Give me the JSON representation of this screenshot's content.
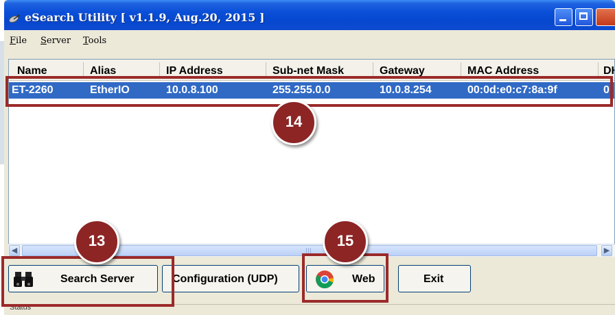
{
  "window": {
    "title": "eSearch Utility [ v1.1.9, Aug.20, 2015 ]"
  },
  "menu": {
    "items": [
      "File",
      "Server",
      "Tools"
    ]
  },
  "table": {
    "columns": [
      "Name",
      "Alias",
      "IP Address",
      "Sub-net Mask",
      "Gateway",
      "MAC Address",
      "DH"
    ],
    "rows": [
      {
        "name": "ET-2260",
        "alias": "EtherIO",
        "ip": "10.0.8.100",
        "mask": "255.255.0.0",
        "gateway": "10.0.8.254",
        "mac": "00:0d:e0:c7:8a:9f",
        "dhcp": "0"
      }
    ]
  },
  "buttons": {
    "search": "Search Server",
    "config": "Configuration (UDP)",
    "web": "Web",
    "exit": "Exit"
  },
  "status": {
    "text": "Status"
  },
  "callouts": [
    "13",
    "14",
    "15"
  ],
  "colors": {
    "title_bar": "#0a4fd8",
    "selection": "#316ac5",
    "callout": "#8d2525"
  },
  "icons": {
    "app": "satellite-dish-icon",
    "search": "binoculars-icon",
    "web": "chrome-icon"
  }
}
